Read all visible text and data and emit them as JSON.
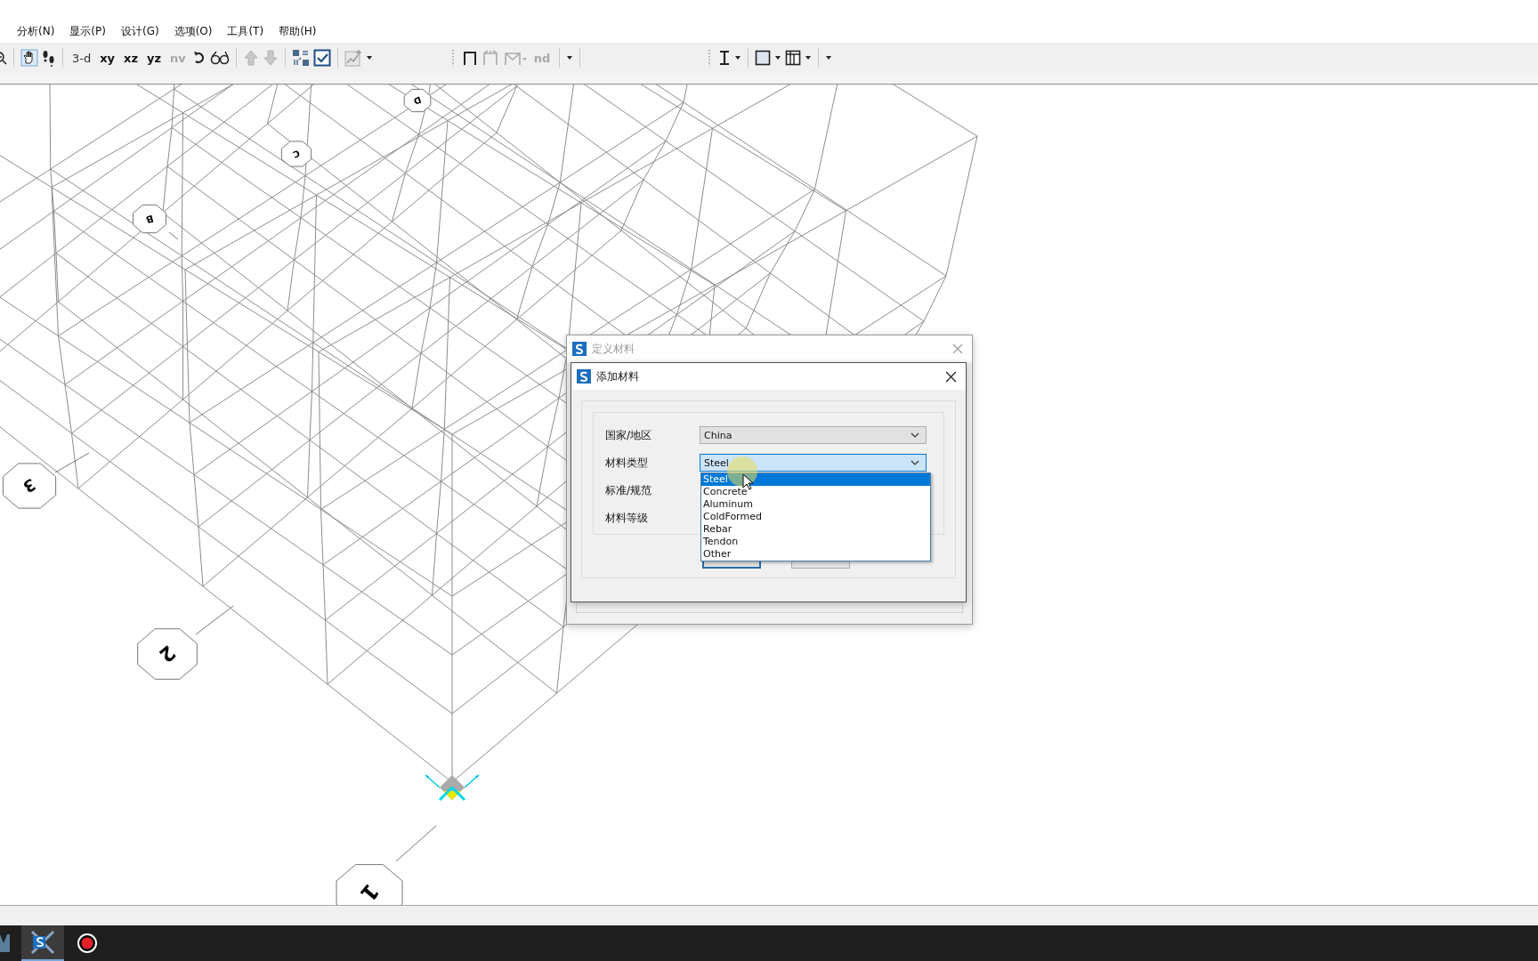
{
  "menu": [
    {
      "label": "分析(N)"
    },
    {
      "label": "显示(P)"
    },
    {
      "label": "设计(G)"
    },
    {
      "label": "选项(O)"
    },
    {
      "label": "工具(T)"
    },
    {
      "label": "帮助(H)"
    }
  ],
  "toolbar": {
    "view_buttons": [
      {
        "label": "3-d",
        "disabled": false
      },
      {
        "label": "xy",
        "disabled": false
      },
      {
        "label": "xz",
        "disabled": false
      },
      {
        "label": "yz",
        "disabled": false
      },
      {
        "label": "nv",
        "disabled": true
      }
    ],
    "nd_button": {
      "label": "nd",
      "disabled": true
    }
  },
  "grid_bubbles": [
    {
      "label": "D"
    },
    {
      "label": "C"
    },
    {
      "label": "B"
    },
    {
      "label": "3"
    },
    {
      "label": "2"
    },
    {
      "label": "1"
    }
  ],
  "define_materials": {
    "title": "定义材料",
    "active": false
  },
  "add_material": {
    "title": "添加材料",
    "active": true,
    "fields": [
      {
        "label": "国家/地区",
        "value": "China",
        "focused": false
      },
      {
        "label": "材料类型",
        "value": "Steel",
        "focused": true
      },
      {
        "label": "标准/规范"
      },
      {
        "label": "材料等级"
      }
    ],
    "dropdown": [
      {
        "label": "Steel",
        "selected": true
      },
      {
        "label": "Concrete",
        "selected": false
      },
      {
        "label": "Aluminum",
        "selected": false
      },
      {
        "label": "ColdFormed",
        "selected": false
      },
      {
        "label": "Rebar",
        "selected": false
      },
      {
        "label": "Tendon",
        "selected": false
      },
      {
        "label": "Other",
        "selected": false
      }
    ]
  }
}
